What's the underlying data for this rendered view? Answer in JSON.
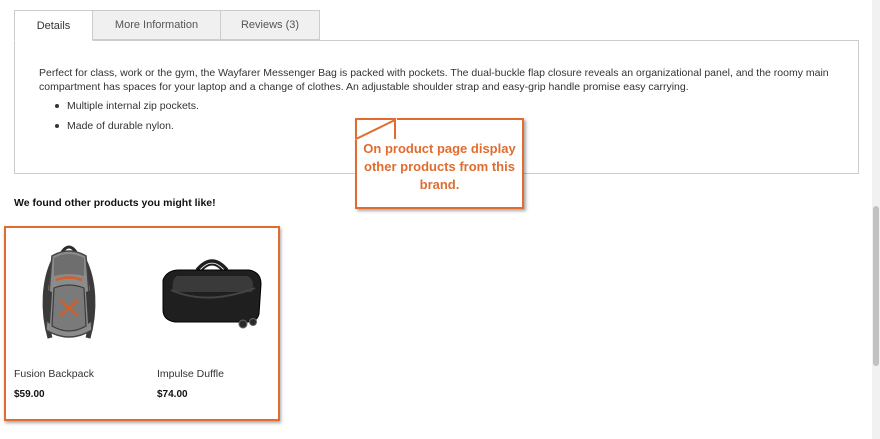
{
  "tabs": [
    {
      "label": "Details",
      "active": true
    },
    {
      "label": "More Information",
      "active": false
    },
    {
      "label": "Reviews (3)",
      "active": false
    }
  ],
  "details": {
    "description": "Perfect for class, work or the gym, the Wayfarer Messenger Bag is packed with pockets. The dual-buckle flap closure reveals an organizational panel, and the roomy main compartment has spaces for your laptop and a change of clothes. An adjustable shoulder strap and easy-grip handle promise easy carrying.",
    "bullets": [
      "Multiple internal zip pockets.",
      "Made of durable nylon."
    ]
  },
  "callout": {
    "text": "On product page display other products from this brand.",
    "color": "#e06d2f"
  },
  "related": {
    "title": "We found other products you might like!",
    "products": [
      {
        "name": "Fusion Backpack",
        "price": "$59.00",
        "image": "backpack-image"
      },
      {
        "name": "Impulse Duffle",
        "price": "$74.00",
        "image": "duffle-bag-image"
      }
    ]
  }
}
